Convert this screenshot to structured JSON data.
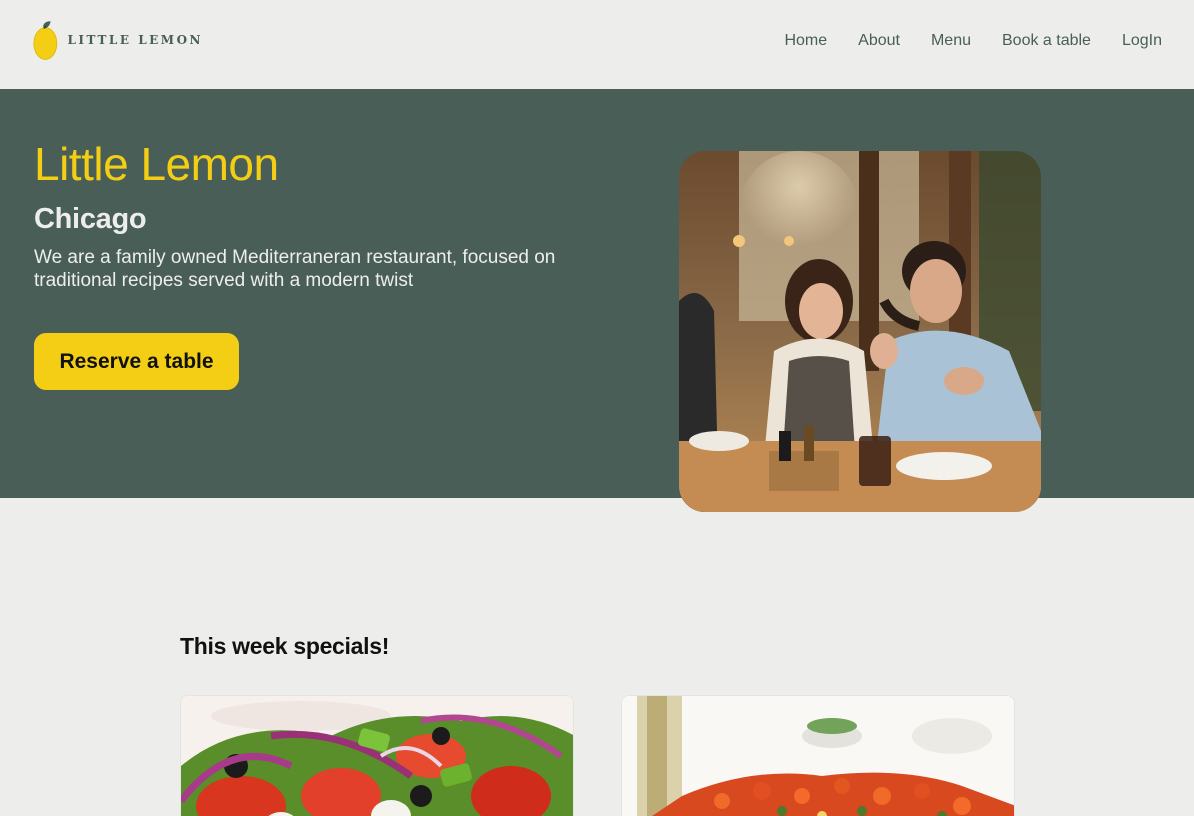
{
  "logo": {
    "text": "LITTLE LEMON",
    "icon": "lemon-icon"
  },
  "nav": {
    "items": [
      {
        "label": "Home"
      },
      {
        "label": "About"
      },
      {
        "label": "Menu"
      },
      {
        "label": "Book a table"
      },
      {
        "label": "LogIn"
      }
    ]
  },
  "hero": {
    "title": "Little Lemon",
    "city": "Chicago",
    "description": "We are a family owned Mediterraneran restaurant, focused on traditional recipes served with a modern twist",
    "button_label": "Reserve a table"
  },
  "specials": {
    "title": "This week specials!"
  },
  "colors": {
    "primary_green": "#495e57",
    "primary_yellow": "#f4ce14",
    "background": "#edeeec"
  }
}
